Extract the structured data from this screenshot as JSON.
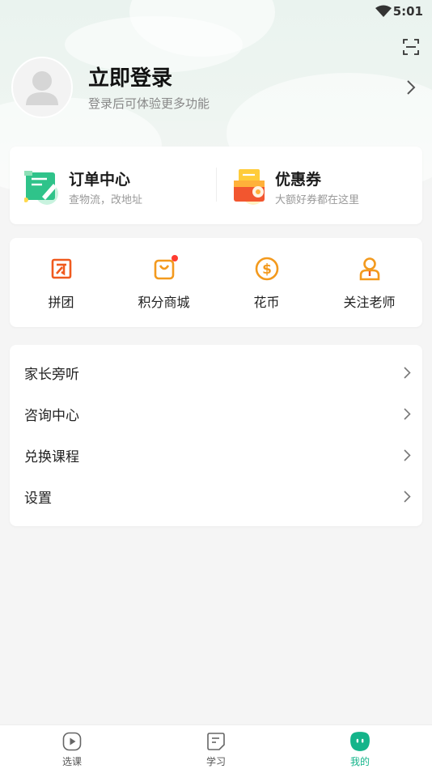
{
  "status_bar": {
    "time": "5:01"
  },
  "profile": {
    "title": "立即登录",
    "subtitle": "登录后可体验更多功能"
  },
  "order_card": {
    "orders": {
      "title": "订单中心",
      "subtitle": "查物流，改地址"
    },
    "coupons": {
      "title": "优惠券",
      "subtitle": "大额好券都在这里"
    }
  },
  "shortcuts": [
    {
      "label": "拼团",
      "icon": "group-buy-icon"
    },
    {
      "label": "积分商城",
      "icon": "points-mall-bag-icon",
      "badge": true
    },
    {
      "label": "花币",
      "icon": "coin-icon"
    },
    {
      "label": "关注老师",
      "icon": "follow-teacher-icon"
    }
  ],
  "menu": [
    {
      "label": "家长旁听"
    },
    {
      "label": "咨询中心"
    },
    {
      "label": "兑换课程"
    },
    {
      "label": "设置"
    }
  ],
  "tabbar": [
    {
      "label": "选课",
      "icon": "play-icon"
    },
    {
      "label": "学习",
      "icon": "study-icon"
    },
    {
      "label": "我的",
      "icon": "mine-icon",
      "active": true
    }
  ],
  "colors": {
    "accent": "#14b48a",
    "orange": "#f39a1e",
    "red_dot": "#ff3b30"
  }
}
